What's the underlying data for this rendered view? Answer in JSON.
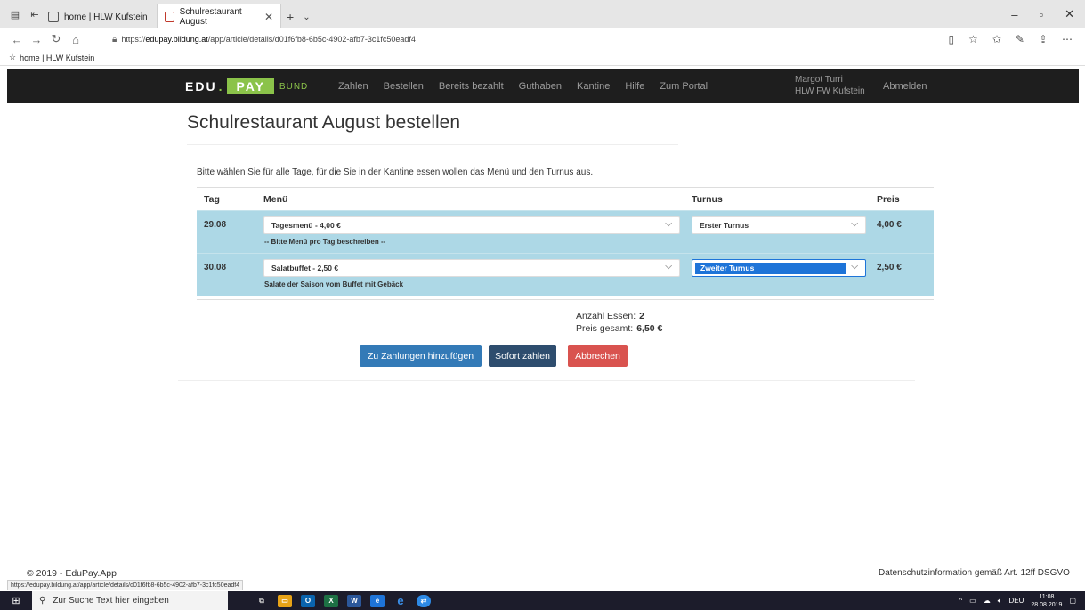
{
  "browser": {
    "tabs": [
      {
        "label": "home | HLW Kufstein",
        "active": false
      },
      {
        "label": "Schulrestaurant August",
        "active": true
      }
    ],
    "url_prefix": "https://",
    "url_domain": "edupay.bildung.at",
    "url_path": "/app/article/details/d01f6fb8-6b5c-4902-afb7-3c1fc50eadf4",
    "favorite": "home | HLW Kufstein",
    "status_url": "https://edupay.bildung.at/app/article/details/d01f6fb8-6b5c-4902-afb7-3c1fc50eadf4"
  },
  "nav": {
    "brand_edu": "EDU",
    "brand_pay": "PAY",
    "brand_bund": "BUND",
    "links": [
      "Zahlen",
      "Bestellen",
      "Bereits bezahlt",
      "Guthaben",
      "Kantine",
      "Hilfe",
      "Zum Portal"
    ],
    "user_name": "Margot Turri",
    "user_school": "HLW FW Kufstein",
    "logout": "Abmelden"
  },
  "page": {
    "title": "Schulrestaurant August bestellen",
    "intro": "Bitte wählen Sie für alle Tage, für die Sie in der Kantine essen wollen das Menü und den Turnus aus.",
    "columns": {
      "tag": "Tag",
      "menu": "Menü",
      "turnus": "Turnus",
      "preis": "Preis"
    },
    "rows": [
      {
        "tag": "29.08",
        "menu": "Tagesmenü - 4,00 €",
        "desc": "-- Bitte Menü pro Tag beschreiben --",
        "turnus": "Erster Turnus",
        "preis": "4,00 €"
      },
      {
        "tag": "30.08",
        "menu": "Salatbuffet - 2,50 €",
        "desc": "Salate der Saison vom Buffet mit Gebäck",
        "turnus": "Zweiter Turnus",
        "preis": "2,50 €"
      }
    ],
    "summary": {
      "count_label": "Anzahl Essen:",
      "count_value": "2",
      "total_label": "Preis gesamt:",
      "total_value": "6,50 €"
    },
    "buttons": {
      "add": "Zu Zahlungen hinzufügen",
      "pay": "Sofort zahlen",
      "cancel": "Abbrechen"
    }
  },
  "footer": {
    "copyright": "© 2019 - EduPay.App",
    "privacy": "Datenschutzinformation gemäß Art. 12ff DSGVO"
  },
  "taskbar": {
    "search_placeholder": "Zur Suche Text hier eingeben",
    "lang": "DEU",
    "time": "11:08",
    "date": "28.08.2019"
  },
  "colors": {
    "navbar": "#1e1e1e",
    "brand_green": "#8bc34a",
    "row_bg": "#add8e6",
    "btn_primary": "#337ab7",
    "btn_dark": "#2e4d6e",
    "btn_danger": "#d9534f"
  }
}
